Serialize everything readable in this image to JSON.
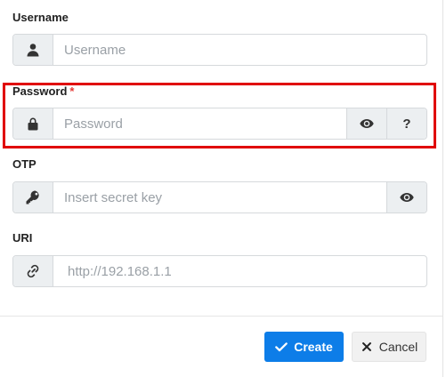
{
  "form": {
    "username": {
      "label": "Username",
      "placeholder": "Username",
      "value": "",
      "icon": "user-icon"
    },
    "password": {
      "label": "Password",
      "required_mark": "*",
      "placeholder": "Password",
      "value": "",
      "icon": "lock-icon",
      "toggle_icon": "eye-icon",
      "help_label": "?"
    },
    "otp": {
      "label": "OTP",
      "placeholder": "Insert secret key",
      "value": "",
      "icon": "key-icon",
      "toggle_icon": "eye-icon"
    },
    "uri": {
      "label": "URI",
      "placeholder": "http://192.168.1.1",
      "value": "",
      "icon": "link-icon"
    }
  },
  "footer": {
    "create_label": "Create",
    "cancel_label": "Cancel"
  },
  "colors": {
    "primary": "#0d7de8",
    "highlight": "#e00000",
    "required": "#e53935"
  }
}
